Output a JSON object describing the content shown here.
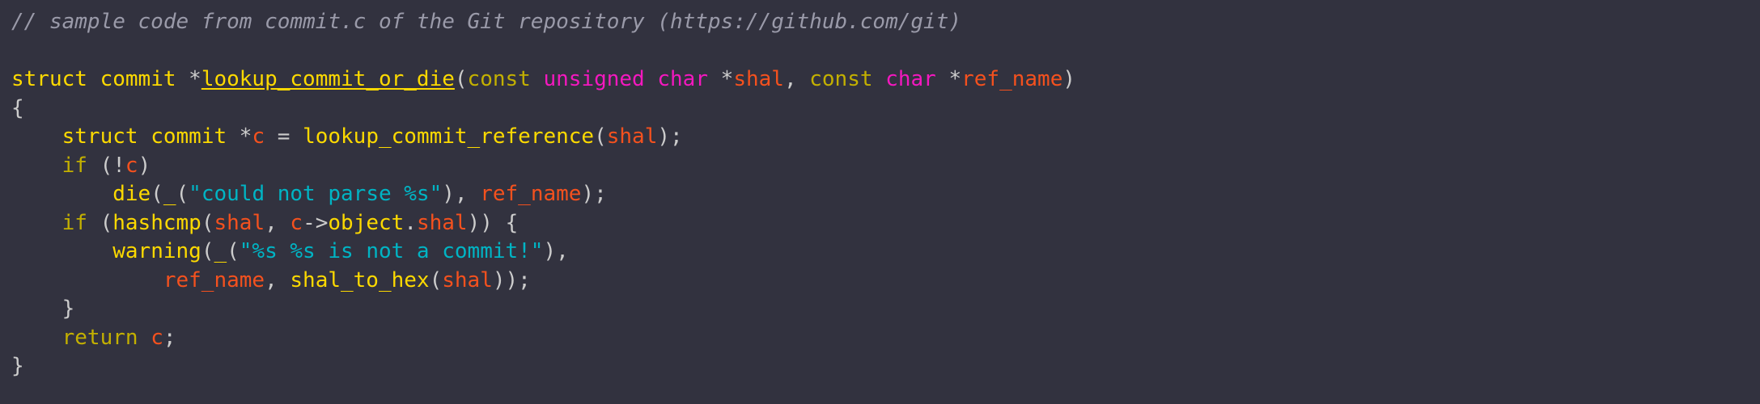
{
  "editor": {
    "background_color": "#32323f",
    "font_size_px": 26,
    "line_height_px": 35.5
  },
  "palette": {
    "comment": "#9a9aa9",
    "type": "#fcd900",
    "keyword": "#c3b000",
    "type_keyword": "#f418bf",
    "variable": "#f4511e",
    "string": "#00b4c4",
    "punctuation": "#cccccc",
    "function": "#fcd900",
    "function_definition": "#fcd900"
  },
  "code": {
    "language": "c",
    "source_note": "// sample code from commit.c of the Git repository (https://github.com/git)",
    "lines": [
      {
        "index": 1,
        "text": "// sample code from commit.c of the Git repository (https://github.com/git)",
        "tokens": [
          {
            "t": "// sample code from commit.c of the Git repository (https://github.com/git)",
            "c": "c-comment"
          }
        ]
      },
      {
        "index": 2,
        "text": "",
        "tokens": []
      },
      {
        "index": 3,
        "text": "struct commit *lookup_commit_or_die(const unsigned char *shal, const char *ref_name)",
        "tokens": [
          {
            "t": "struct",
            "c": "c-type"
          },
          {
            "t": " ",
            "c": "c-plain"
          },
          {
            "t": "commit",
            "c": "c-type"
          },
          {
            "t": " ",
            "c": "c-plain"
          },
          {
            "t": "*",
            "c": "c-punct"
          },
          {
            "t": "lookup_commit_or_die",
            "c": "c-funcdef"
          },
          {
            "t": "(",
            "c": "c-punct"
          },
          {
            "t": "const",
            "c": "c-keyword"
          },
          {
            "t": " ",
            "c": "c-plain"
          },
          {
            "t": "unsigned",
            "c": "c-typekw"
          },
          {
            "t": " ",
            "c": "c-plain"
          },
          {
            "t": "char",
            "c": "c-typekw"
          },
          {
            "t": " ",
            "c": "c-plain"
          },
          {
            "t": "*",
            "c": "c-punct"
          },
          {
            "t": "shal",
            "c": "c-var"
          },
          {
            "t": ",",
            "c": "c-punct"
          },
          {
            "t": " ",
            "c": "c-plain"
          },
          {
            "t": "const",
            "c": "c-keyword"
          },
          {
            "t": " ",
            "c": "c-plain"
          },
          {
            "t": "char",
            "c": "c-typekw"
          },
          {
            "t": " ",
            "c": "c-plain"
          },
          {
            "t": "*",
            "c": "c-punct"
          },
          {
            "t": "ref_name",
            "c": "c-var"
          },
          {
            "t": ")",
            "c": "c-punct"
          }
        ]
      },
      {
        "index": 4,
        "text": "{",
        "tokens": [
          {
            "t": "{",
            "c": "c-punct"
          }
        ]
      },
      {
        "index": 5,
        "text": "    struct commit *c = lookup_commit_reference(shal);",
        "tokens": [
          {
            "t": "    ",
            "c": "c-plain"
          },
          {
            "t": "struct",
            "c": "c-type"
          },
          {
            "t": " ",
            "c": "c-plain"
          },
          {
            "t": "commit",
            "c": "c-type"
          },
          {
            "t": " ",
            "c": "c-plain"
          },
          {
            "t": "*",
            "c": "c-punct"
          },
          {
            "t": "c",
            "c": "c-var"
          },
          {
            "t": " ",
            "c": "c-plain"
          },
          {
            "t": "=",
            "c": "c-punct"
          },
          {
            "t": " ",
            "c": "c-plain"
          },
          {
            "t": "lookup_commit_reference",
            "c": "c-func"
          },
          {
            "t": "(",
            "c": "c-punct"
          },
          {
            "t": "shal",
            "c": "c-var"
          },
          {
            "t": ")",
            "c": "c-punct"
          },
          {
            "t": ";",
            "c": "c-punct"
          }
        ]
      },
      {
        "index": 6,
        "text": "    if (!c)",
        "tokens": [
          {
            "t": "    ",
            "c": "c-plain"
          },
          {
            "t": "if",
            "c": "c-keyword"
          },
          {
            "t": " ",
            "c": "c-plain"
          },
          {
            "t": "(",
            "c": "c-punct"
          },
          {
            "t": "!",
            "c": "c-punct"
          },
          {
            "t": "c",
            "c": "c-var"
          },
          {
            "t": ")",
            "c": "c-punct"
          }
        ]
      },
      {
        "index": 7,
        "text": "        die(_(\"could not parse %s\"), ref_name);",
        "tokens": [
          {
            "t": "        ",
            "c": "c-plain"
          },
          {
            "t": "die",
            "c": "c-func"
          },
          {
            "t": "(",
            "c": "c-punct"
          },
          {
            "t": "_",
            "c": "c-func"
          },
          {
            "t": "(",
            "c": "c-punct"
          },
          {
            "t": "\"could not parse %s\"",
            "c": "c-string"
          },
          {
            "t": ")",
            "c": "c-punct"
          },
          {
            "t": ",",
            "c": "c-punct"
          },
          {
            "t": " ",
            "c": "c-plain"
          },
          {
            "t": "ref_name",
            "c": "c-var"
          },
          {
            "t": ")",
            "c": "c-punct"
          },
          {
            "t": ";",
            "c": "c-punct"
          }
        ]
      },
      {
        "index": 8,
        "text": "    if (hashcmp(shal, c->object.shal)) {",
        "tokens": [
          {
            "t": "    ",
            "c": "c-plain"
          },
          {
            "t": "if",
            "c": "c-keyword"
          },
          {
            "t": " ",
            "c": "c-plain"
          },
          {
            "t": "(",
            "c": "c-punct"
          },
          {
            "t": "hashcmp",
            "c": "c-func"
          },
          {
            "t": "(",
            "c": "c-punct"
          },
          {
            "t": "shal",
            "c": "c-var"
          },
          {
            "t": ",",
            "c": "c-punct"
          },
          {
            "t": " ",
            "c": "c-plain"
          },
          {
            "t": "c",
            "c": "c-var"
          },
          {
            "t": "->",
            "c": "c-punct"
          },
          {
            "t": "object",
            "c": "c-type"
          },
          {
            "t": ".",
            "c": "c-punct"
          },
          {
            "t": "shal",
            "c": "c-var"
          },
          {
            "t": ")",
            "c": "c-punct"
          },
          {
            "t": ")",
            "c": "c-punct"
          },
          {
            "t": " ",
            "c": "c-plain"
          },
          {
            "t": "{",
            "c": "c-punct"
          }
        ]
      },
      {
        "index": 9,
        "text": "        warning(_(\"%s %s is not a commit!\"),",
        "tokens": [
          {
            "t": "        ",
            "c": "c-plain"
          },
          {
            "t": "warning",
            "c": "c-func"
          },
          {
            "t": "(",
            "c": "c-punct"
          },
          {
            "t": "_",
            "c": "c-func"
          },
          {
            "t": "(",
            "c": "c-punct"
          },
          {
            "t": "\"%s %s is not a commit!\"",
            "c": "c-string"
          },
          {
            "t": ")",
            "c": "c-punct"
          },
          {
            "t": ",",
            "c": "c-punct"
          }
        ]
      },
      {
        "index": 10,
        "text": "            ref_name, shal_to_hex(shal));",
        "tokens": [
          {
            "t": "            ",
            "c": "c-plain"
          },
          {
            "t": "ref_name",
            "c": "c-var"
          },
          {
            "t": ",",
            "c": "c-punct"
          },
          {
            "t": " ",
            "c": "c-plain"
          },
          {
            "t": "shal_to_hex",
            "c": "c-func"
          },
          {
            "t": "(",
            "c": "c-punct"
          },
          {
            "t": "shal",
            "c": "c-var"
          },
          {
            "t": ")",
            "c": "c-punct"
          },
          {
            "t": ")",
            "c": "c-punct"
          },
          {
            "t": ";",
            "c": "c-punct"
          }
        ]
      },
      {
        "index": 11,
        "text": "    }",
        "tokens": [
          {
            "t": "    ",
            "c": "c-plain"
          },
          {
            "t": "}",
            "c": "c-punct"
          }
        ]
      },
      {
        "index": 12,
        "text": "    return c;",
        "tokens": [
          {
            "t": "    ",
            "c": "c-plain"
          },
          {
            "t": "return",
            "c": "c-keyword"
          },
          {
            "t": " ",
            "c": "c-plain"
          },
          {
            "t": "c",
            "c": "c-var"
          },
          {
            "t": ";",
            "c": "c-punct"
          }
        ]
      },
      {
        "index": 13,
        "text": "}",
        "tokens": [
          {
            "t": "}",
            "c": "c-punct"
          }
        ]
      }
    ]
  }
}
